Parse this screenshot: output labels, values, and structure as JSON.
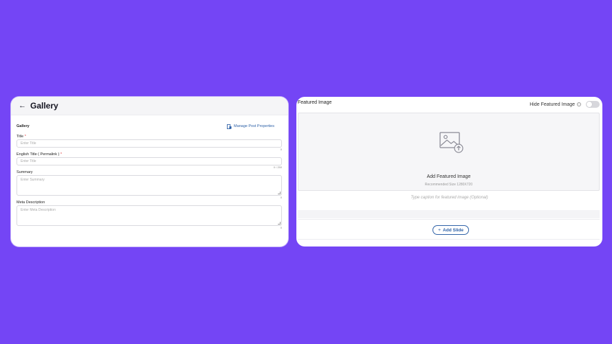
{
  "left_panel": {
    "title": "Gallery",
    "section_title": "Gallery",
    "manage_link": "Manage Post Properties",
    "fields": [
      {
        "label": "Title",
        "required": "*",
        "placeholder": "Enter Title",
        "counter": "0"
      },
      {
        "label": "English Title ( Permalink )",
        "required": "*",
        "placeholder": "Enter Title",
        "counter": "0 / 250"
      },
      {
        "label": "Summary",
        "required": "",
        "placeholder": "Enter Summary",
        "counter": "0"
      },
      {
        "label": "Meta Description",
        "required": "",
        "placeholder": "Enter Meta Description",
        "counter": "0"
      }
    ]
  },
  "right_panel": {
    "title": "Featured Image",
    "hide_label": "Hide Featured Image",
    "hide_toggle_on": false,
    "dropzone_title": "Add Featured Image",
    "dropzone_sub": "Recommended Size 1280X720",
    "caption_placeholder": "Type caption for featured image (Optional)",
    "add_slide_label": "Add Slide"
  },
  "colors": {
    "background": "#7445f5",
    "accent": "#2b5fa6",
    "required": "#dd3333"
  }
}
